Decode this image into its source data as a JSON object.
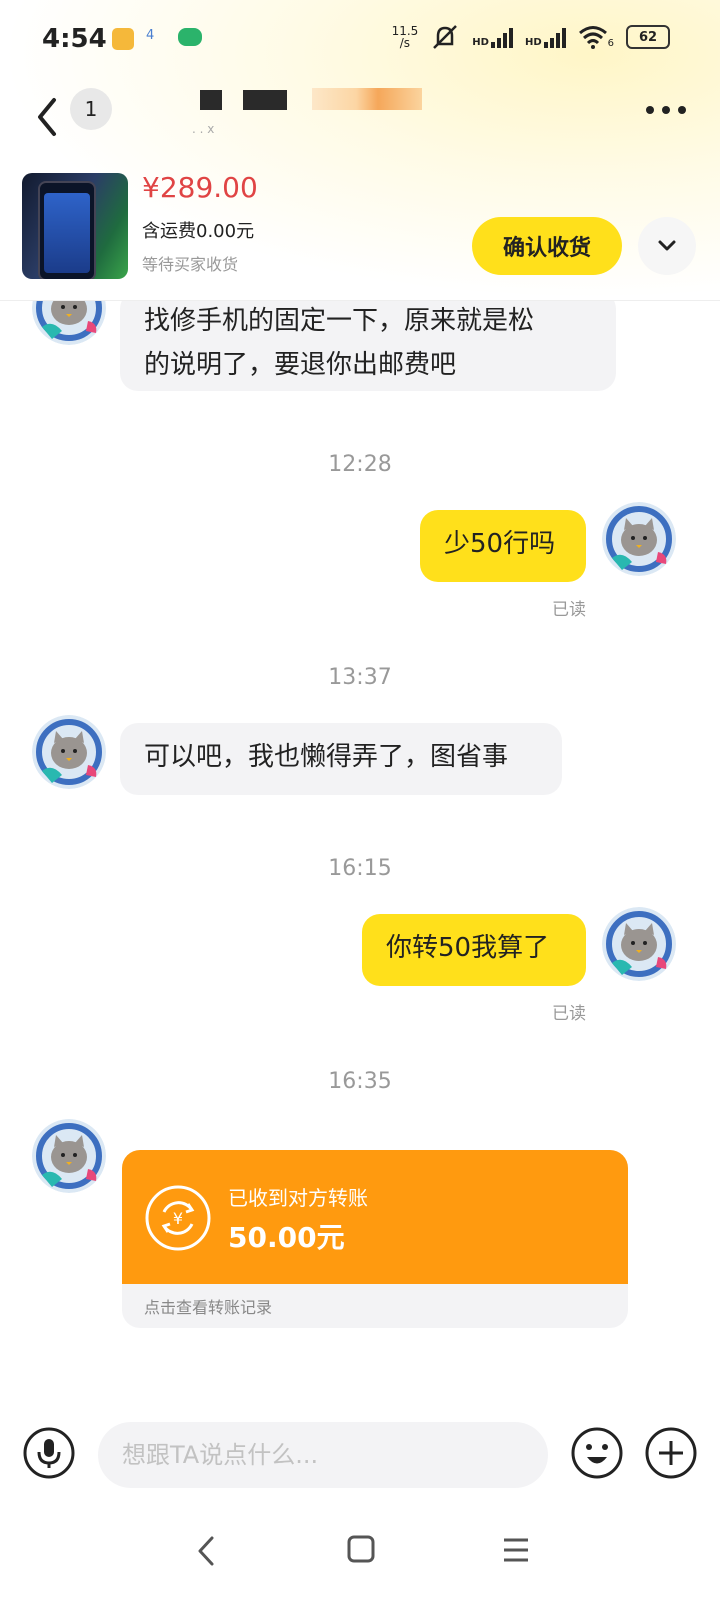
{
  "status_bar": {
    "time": "4:54",
    "app_badge": "4",
    "net_speed_value": "11.5",
    "net_speed_unit": "/s",
    "sim1": "HD",
    "sim2": "HD",
    "wifi_sub": "6",
    "battery": "62"
  },
  "header": {
    "avatar_text": "1",
    "subtitle": ". . x"
  },
  "product": {
    "price": "¥289.00",
    "shipping": "含运费0.00元",
    "status": "等待买家收货",
    "confirm_label": "确认收货"
  },
  "messages": [
    {
      "side": "them",
      "text_line1": "找修手机的固定一下，原来就是松",
      "text_line2": "的说明了，要退你出邮费吧"
    },
    {
      "time": "12:28"
    },
    {
      "side": "me",
      "text": "少50行吗",
      "read": "已读"
    },
    {
      "time": "13:37"
    },
    {
      "side": "them",
      "text": "可以吧，我也懒得弄了，图省事"
    },
    {
      "time": "16:15"
    },
    {
      "side": "me",
      "text": "你转50我算了",
      "read": "已读"
    },
    {
      "time": "16:35"
    }
  ],
  "transfer": {
    "title": "已收到对方转账",
    "amount": "50.00元",
    "footer": "点击查看转账记录",
    "accent_color": "#ff9a0f"
  },
  "input": {
    "placeholder": "想跟TA说点什么..."
  },
  "colors": {
    "brand_yellow": "#ffe01b",
    "price_red": "#e04444"
  },
  "icons": [
    "back-arrow",
    "more-dots",
    "chevron-down",
    "mic",
    "emoji",
    "plus",
    "nav-back",
    "nav-home",
    "nav-menu"
  ]
}
